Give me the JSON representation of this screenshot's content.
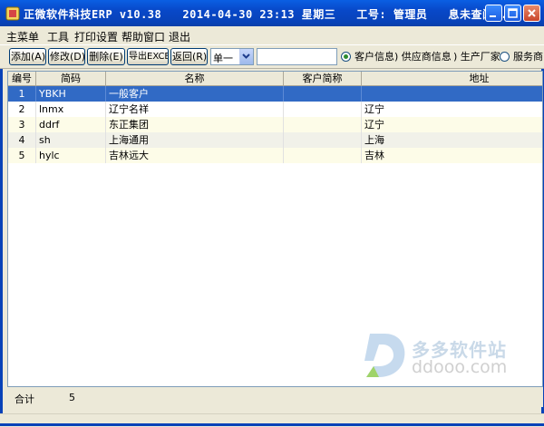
{
  "window": {
    "title": "正微软件科技ERP v10.38   2014-04-30 23:13 星期三   工号: 管理员   息未查阅..."
  },
  "menu": [
    "主菜单",
    "工具",
    "打印设置",
    "帮助窗口",
    "退出"
  ],
  "toolbar": {
    "buttons": [
      "添加(A)",
      "修改(D)",
      "删除(E)",
      "导出EXCEL",
      "返回(R)"
    ],
    "dropdown_value": "单一",
    "search_value": "",
    "radios": [
      {
        "label": "客户信息",
        "selected": true
      },
      {
        "label": "供应商信息",
        "selected": false
      },
      {
        "label": "生产厂家",
        "selected": false
      },
      {
        "label": "服务商",
        "selected": false
      }
    ]
  },
  "table": {
    "columns": [
      "编号",
      "简码",
      "名称",
      "客户简称",
      "地址"
    ],
    "rows": [
      [
        "1",
        "YBKH",
        "一般客户",
        "",
        ""
      ],
      [
        "2",
        "lnmx",
        "辽宁名祥",
        "",
        "辽宁"
      ],
      [
        "3",
        "ddrf",
        "东正集团",
        "",
        "辽宁"
      ],
      [
        "4",
        "sh",
        "上海通用",
        "",
        "上海"
      ],
      [
        "5",
        "hylc",
        "吉林远大",
        "",
        "吉林"
      ]
    ],
    "selected_row": 0
  },
  "footer": {
    "label": "合计",
    "count": "5"
  },
  "watermark": {
    "name": "多多软件站",
    "url": "ddooo.com"
  }
}
